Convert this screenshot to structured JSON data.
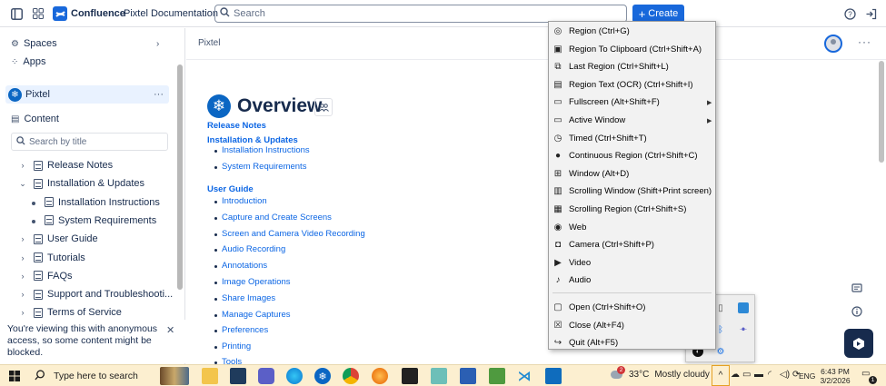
{
  "topbar": {
    "brand_name": "Confluence",
    "space_name": "Pixtel Documentation",
    "search_placeholder": "Search",
    "create_label": "Create"
  },
  "sidebar": {
    "spaces_label": "Spaces",
    "apps_label": "Apps",
    "space_label": "Pixtel",
    "content_label": "Content",
    "search_placeholder": "Search by title",
    "tree": [
      {
        "label": "Release Notes",
        "level": 0,
        "chevron": "right"
      },
      {
        "label": "Installation & Updates",
        "level": 0,
        "chevron": "down"
      },
      {
        "label": "Installation Instructions",
        "level": 1,
        "chevron": "bullet"
      },
      {
        "label": "System Requirements",
        "level": 1,
        "chevron": "bullet"
      },
      {
        "label": "User Guide",
        "level": 0,
        "chevron": "right"
      },
      {
        "label": "Tutorials",
        "level": 0,
        "chevron": "right"
      },
      {
        "label": "FAQs",
        "level": 0,
        "chevron": "right"
      },
      {
        "label": "Support and Troubleshooti...",
        "level": 0,
        "chevron": "right"
      },
      {
        "label": "Terms of Service",
        "level": 0,
        "chevron": "right"
      }
    ],
    "notice": "You're viewing this with anonymous access, so some content might be blocked."
  },
  "main": {
    "breadcrumb": "Pixtel",
    "title": "Overview",
    "links": [
      {
        "text": "Release Notes",
        "bold": true,
        "bullet": false
      },
      {
        "text": "Installation & Updates",
        "bold": true,
        "bullet": false
      },
      {
        "text": "Installation Instructions",
        "bold": false,
        "bullet": true
      },
      {
        "text": "System Requirements",
        "bold": false,
        "bullet": true
      },
      {
        "text": "User Guide",
        "bold": true,
        "bullet": false
      },
      {
        "text": "Introduction",
        "bold": false,
        "bullet": true
      },
      {
        "text": "Capture and Create Screens",
        "bold": false,
        "bullet": true
      },
      {
        "text": "Screen and Camera Video Recording",
        "bold": false,
        "bullet": true
      },
      {
        "text": "Audio Recording",
        "bold": false,
        "bullet": true
      },
      {
        "text": "Annotations",
        "bold": false,
        "bullet": true
      },
      {
        "text": "Image Operations",
        "bold": false,
        "bullet": true
      },
      {
        "text": "Share Images",
        "bold": false,
        "bullet": true
      },
      {
        "text": "Manage Captures",
        "bold": false,
        "bullet": true
      },
      {
        "text": "Preferences",
        "bold": false,
        "bullet": true
      },
      {
        "text": "Printing",
        "bold": false,
        "bullet": true
      },
      {
        "text": "Tools",
        "bold": false,
        "bullet": true
      }
    ]
  },
  "context_menu": {
    "items": [
      {
        "label": "Region (Ctrl+G)",
        "icon": "target-icon",
        "submenu": false
      },
      {
        "label": "Region To Clipboard (Ctrl+Shift+A)",
        "icon": "clipboard-region-icon",
        "submenu": false
      },
      {
        "label": "Last Region (Ctrl+Shift+L)",
        "icon": "last-region-icon",
        "submenu": false
      },
      {
        "label": "Region Text (OCR) (Ctrl+Shift+I)",
        "icon": "ocr-icon",
        "submenu": false
      },
      {
        "label": "Fullscreen (Alt+Shift+F)",
        "icon": "fullscreen-icon",
        "submenu": true
      },
      {
        "label": "Active Window",
        "icon": "window-icon",
        "submenu": true
      },
      {
        "label": "Timed (Ctrl+Shift+T)",
        "icon": "timer-icon",
        "submenu": false
      },
      {
        "label": "Continuous Region (Ctrl+Shift+C)",
        "icon": "continuous-icon",
        "submenu": false
      },
      {
        "label": "Window (Alt+D)",
        "icon": "windows-grid-icon",
        "submenu": false
      },
      {
        "label": "Scrolling Window (Shift+Print screen)",
        "icon": "scroll-window-icon",
        "submenu": false
      },
      {
        "label": "Scrolling Region (Ctrl+Shift+S)",
        "icon": "scroll-region-icon",
        "submenu": false
      },
      {
        "label": "Web",
        "icon": "globe-icon",
        "submenu": false
      },
      {
        "label": "Camera (Ctrl+Shift+P)",
        "icon": "camera-icon",
        "submenu": false
      },
      {
        "label": "Video",
        "icon": "video-icon",
        "submenu": false
      },
      {
        "label": "Audio",
        "icon": "audio-icon",
        "submenu": false
      },
      {
        "label": "Open (Ctrl+Shift+O)",
        "icon": "open-icon",
        "submenu": false
      },
      {
        "label": "Close (Alt+F4)",
        "icon": "close-box-icon",
        "submenu": false
      },
      {
        "label": "Quit (Alt+F5)",
        "icon": "quit-icon",
        "submenu": false
      }
    ]
  },
  "taskbar": {
    "search_placeholder": "Type here to search",
    "weather_temp": "33°C",
    "weather_text": "Mostly cloudy",
    "language": "ENG",
    "time": "6:43 PM",
    "date": "3/2/2026",
    "notification_count": "1",
    "weather_badge": "2"
  },
  "colors": {
    "brand": "#1868db",
    "link": "#0c66e4",
    "taskbar": "#fcefd0",
    "tray_highlight": "#e5a023"
  }
}
